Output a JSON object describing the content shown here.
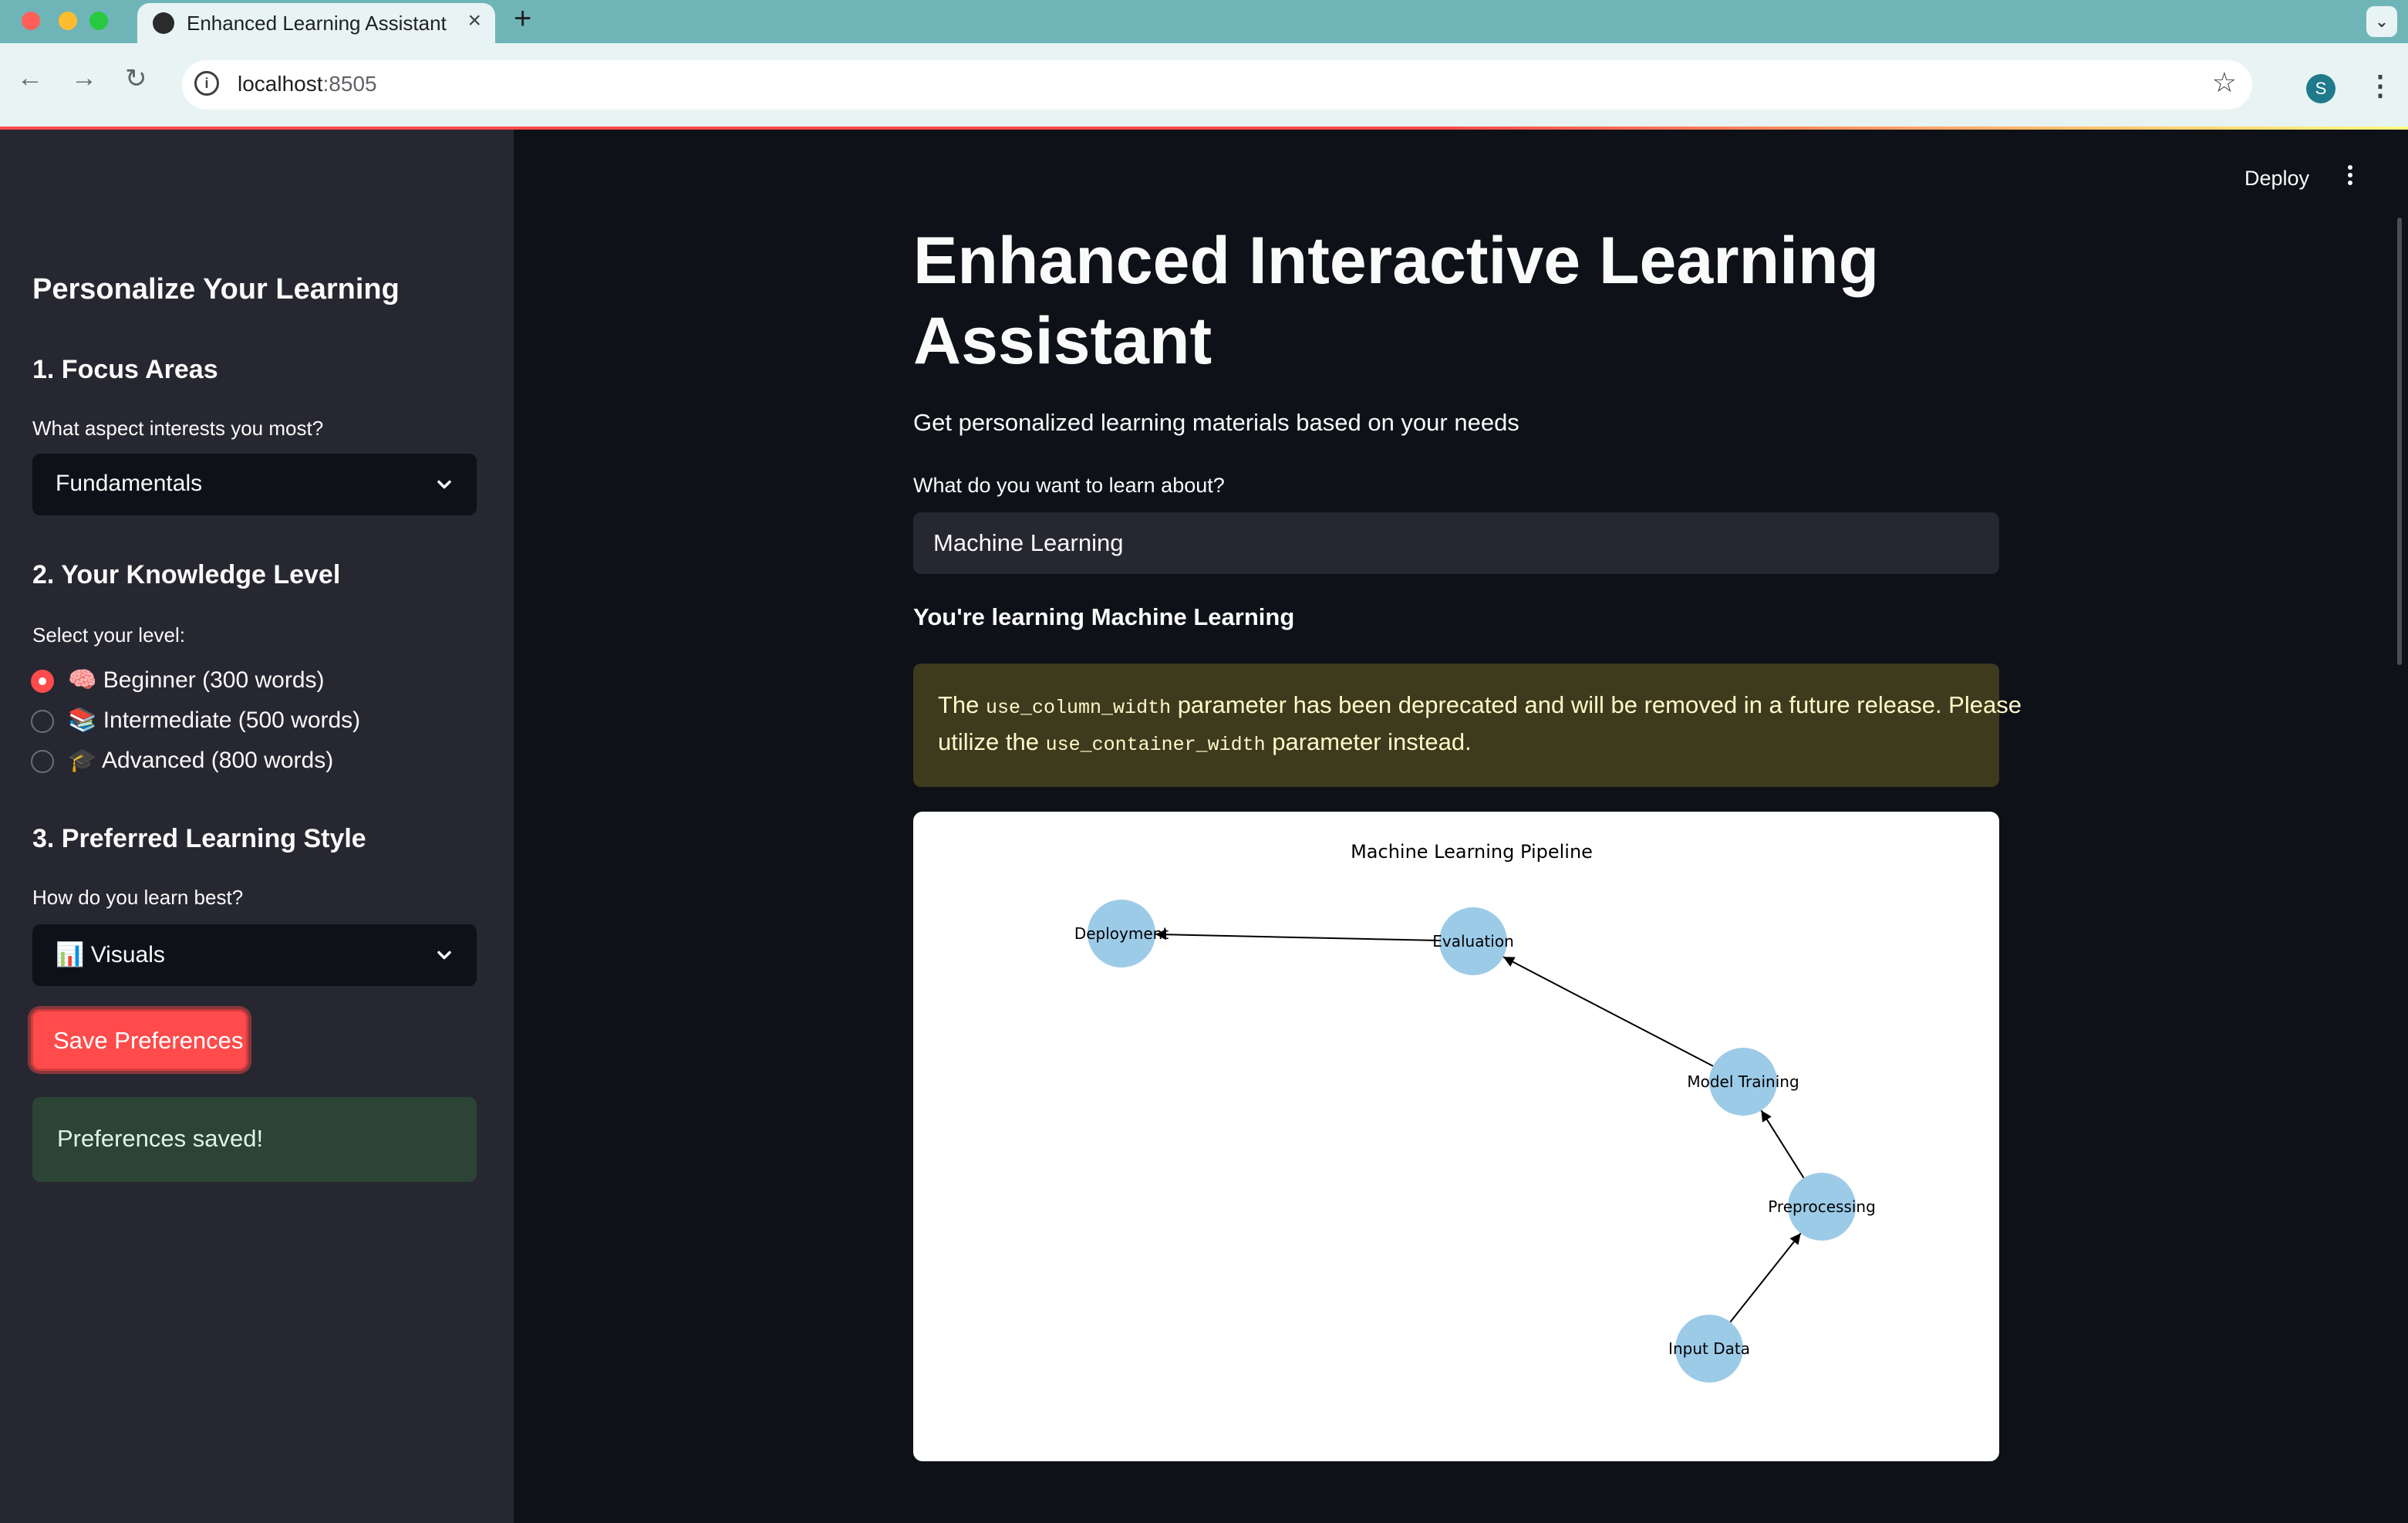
{
  "browser": {
    "tab_title": "Enhanced Learning Assistant",
    "url_host": "localhost",
    "url_port": ":8505",
    "profile_initial": "S"
  },
  "sidebar": {
    "heading": "Personalize Your Learning",
    "focus": {
      "title": "1. Focus Areas",
      "label": "What aspect interests you most?",
      "value": "Fundamentals"
    },
    "knowledge": {
      "title": "2. Your Knowledge Level",
      "label": "Select your level:",
      "options": [
        {
          "label": "🧠 Beginner (300 words)",
          "selected": true
        },
        {
          "label": "📚 Intermediate (500 words)",
          "selected": false
        },
        {
          "label": "🎓 Advanced (800 words)",
          "selected": false
        }
      ]
    },
    "style": {
      "title": "3. Preferred Learning Style",
      "label": "How do you learn best?",
      "value": "📊 Visuals"
    },
    "save_label": "Save Preferences",
    "success_message": "Preferences saved!"
  },
  "header": {
    "deploy_label": "Deploy"
  },
  "main": {
    "title": "Enhanced Interactive Learning Assistant",
    "subtitle": "Get personalized learning materials based on your needs",
    "input_label": "What do you want to learn about?",
    "input_value": "Machine Learning",
    "learning_text": "You're learning Machine Learning",
    "warning": {
      "part1": "The ",
      "code1": "use_column_width",
      "part2": " parameter has been deprecated and will be removed in a future release. Please",
      "part3": "utilize the ",
      "code2": "use_container_width",
      "part4": " parameter instead."
    }
  },
  "diagram": {
    "title": "Machine Learning Pipeline",
    "nodes": [
      "Input Data",
      "Preprocessing",
      "Model Training",
      "Evaluation",
      "Deployment"
    ],
    "edges": [
      [
        "Input Data",
        "Preprocessing"
      ],
      [
        "Preprocessing",
        "Model Training"
      ],
      [
        "Model Training",
        "Evaluation"
      ],
      [
        "Evaluation",
        "Deployment"
      ]
    ],
    "node_color": "#9ccbe8"
  },
  "colors": {
    "accent": "#ff4b4b",
    "sidebar_bg": "#262730",
    "main_bg": "#0e1117"
  }
}
